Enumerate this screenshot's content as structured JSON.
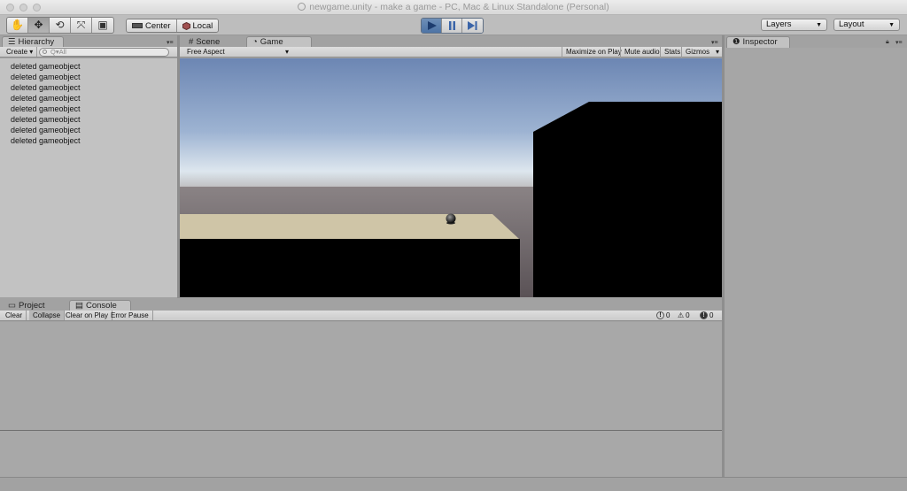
{
  "window": {
    "title": "newgame.unity - make a game - PC, Mac & Linux Standalone (Personal)"
  },
  "toolbar": {
    "tools": [
      {
        "name": "hand-tool",
        "glyph": "✋"
      },
      {
        "name": "move-tool",
        "glyph": "✥"
      },
      {
        "name": "rotate-tool",
        "glyph": "⟲"
      },
      {
        "name": "scale-tool",
        "glyph": "⤧"
      },
      {
        "name": "rect-tool",
        "glyph": "▣"
      }
    ],
    "pivot_label": "Center",
    "space_label": "Local",
    "layers_label": "Layers",
    "layout_label": "Layout"
  },
  "hierarchy": {
    "tab_label": "Hierarchy",
    "create_label": "Create",
    "search_placeholder": "Q▾All",
    "items": [
      "deleted gameobject",
      "deleted gameobject",
      "deleted gameobject",
      "deleted gameobject",
      "deleted gameobject",
      "deleted gameobject",
      "deleted gameobject",
      "deleted gameobject"
    ]
  },
  "scene_tabs": {
    "scene_label": "Scene",
    "game_label": "Game"
  },
  "game_toolbar": {
    "aspect_label": "Free Aspect",
    "maximize_label": "Maximize on Play",
    "mute_label": "Mute audio",
    "stats_label": "Stats",
    "gizmos_label": "Gizmos"
  },
  "inspector": {
    "tab_label": "Inspector"
  },
  "bottom_tabs": {
    "project_label": "Project",
    "console_label": "Console"
  },
  "console": {
    "clear_label": "Clear",
    "collapse_label": "Collapse",
    "clear_on_play_label": "Clear on Play",
    "error_pause_label": "Error Pause",
    "info_count": "0",
    "warning_count": "0",
    "error_count": "0"
  },
  "colors": {
    "sky_top": "#6c86b3",
    "sky_horizon": "#dde6ee",
    "ground": "#6c6466",
    "platform_top": "#cfc5a7",
    "play_active": "#4d73a5"
  }
}
